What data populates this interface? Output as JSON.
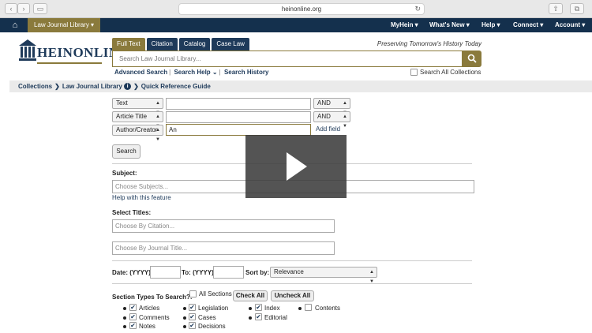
{
  "browser": {
    "url": "heinonline.org"
  },
  "topbar": {
    "library": "Law Journal Library ▾",
    "menus": [
      "MyHein ▾",
      "What's New ▾",
      "Help ▾",
      "Connect ▾",
      "Account ▾"
    ]
  },
  "logo": {
    "text": "HEINONLINE"
  },
  "tabs": [
    "Full Text",
    "Citation",
    "Catalog",
    "Case Law"
  ],
  "tagline": "Preserving Tomorrow's History Today",
  "search": {
    "placeholder": "Search Law Journal Library..."
  },
  "links": {
    "advanced": "Advanced Search",
    "help": "Search Help ⌄",
    "history": "Search History"
  },
  "search_all": "Search All Collections",
  "breadcrumb": {
    "collections": "Collections",
    "library": "Law Journal Library",
    "guide": "Quick Reference Guide"
  },
  "form": {
    "rows": [
      {
        "field": "Text",
        "value": "",
        "op": "AND"
      },
      {
        "field": "Article Title",
        "value": "",
        "op": "AND"
      },
      {
        "field": "Author/Creator",
        "value": "An"
      }
    ],
    "add_field": "Add field",
    "search_button": "Search",
    "subject_label": "Subject:",
    "subject_placeholder": "Choose Subjects...",
    "help_feature": "Help with this feature",
    "titles_label": "Select Titles:",
    "citation_placeholder": "Choose By Citation...",
    "journal_placeholder": "Choose By Journal Title...",
    "date_label": "Date: (YYYY)",
    "to_label": "To: (YYYY)",
    "sort_label": "Sort by:",
    "sort_value": "Relevance",
    "section_label": "Section Types To Search?:",
    "all_sections": "All Sections",
    "check_all": "Check All",
    "uncheck_all": "Uncheck All",
    "types": [
      [
        "Articles",
        "Legislation",
        "Index",
        "Contents"
      ],
      [
        "Comments",
        "Cases",
        "Editorial"
      ],
      [
        "Notes",
        "Decisions"
      ]
    ]
  }
}
